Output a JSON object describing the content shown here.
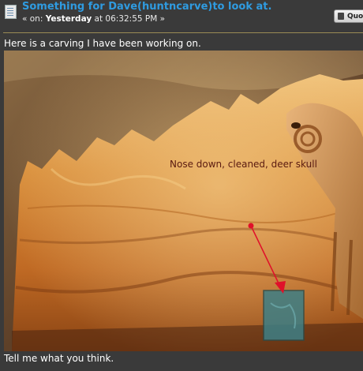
{
  "post": {
    "subject": "Something for Dave(huntncarve)to look at.",
    "meta_prefix": "« on: ",
    "meta_day": "Yesterday",
    "meta_time": " at 06:32:55 PM »",
    "quote_label": "Quote"
  },
  "body": {
    "intro": "Here is a carving I have been working on.",
    "outro": "Tell me what you think."
  },
  "image": {
    "annotation": "Nose down, cleaned, deer skull"
  },
  "colors": {
    "subject": "#2f9be0",
    "background": "#3a3a3a",
    "annotation_arrow": "#e0102a",
    "highlight_box": "#3d7f86"
  },
  "icons": {
    "post": "document-icon",
    "quote": "quote-icon"
  }
}
